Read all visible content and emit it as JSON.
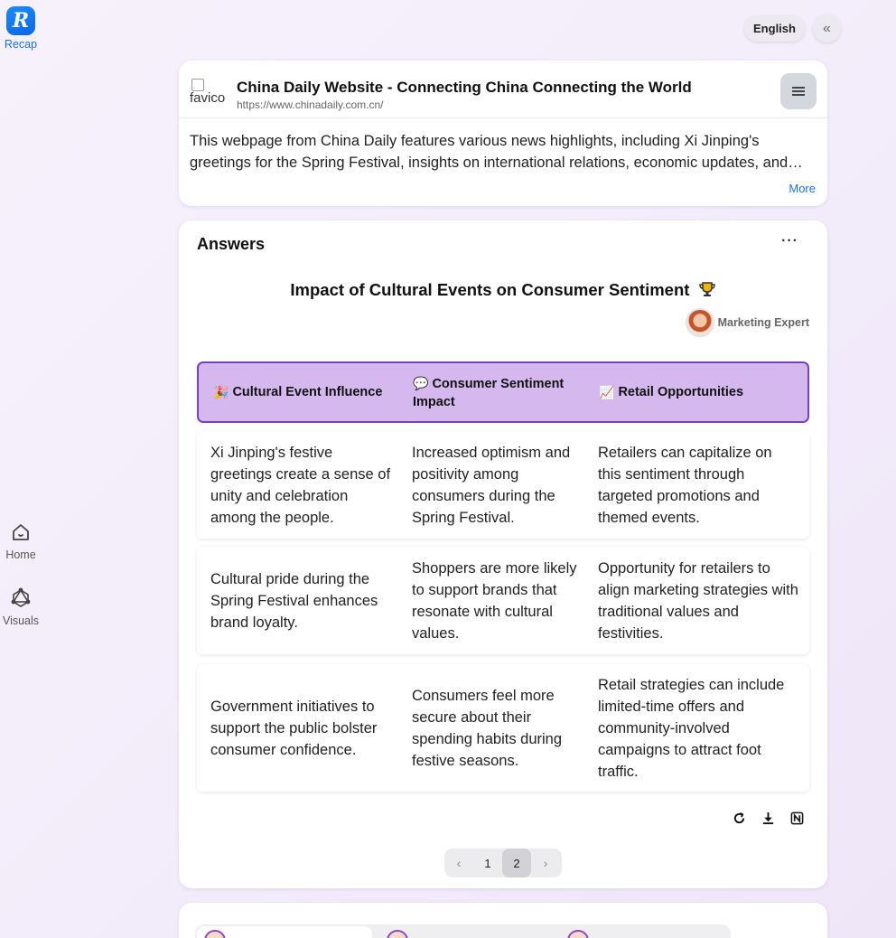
{
  "rail": {
    "logo_label": "Recap",
    "home_label": "Home",
    "visuals_label": "Visuals"
  },
  "topbar": {
    "language": "English",
    "collapse_icon": "double-chevron-left-icon"
  },
  "source": {
    "favicon_alt": "favicon",
    "title": "China Daily Website - Connecting China Connecting the World",
    "url": "https://www.chinadaily.com.cn/",
    "summary": "This webpage from China Daily features various news highlights, including Xi Jinping's greetings for the Spring Festival, insights on international relations, economic updates, and cultural stories.",
    "more_label": "More"
  },
  "answers": {
    "heading": "Answers",
    "menu": "···",
    "table_title": "Impact of Cultural Events on Consumer Sentiment",
    "expert_label": "Marketing Expert",
    "columns": [
      {
        "emoji": "🎉",
        "label": "Cultural Event Influence"
      },
      {
        "emoji": "💬",
        "label": "Consumer Sentiment Impact"
      },
      {
        "emoji": "📈",
        "label": "Retail Opportunities"
      }
    ],
    "rows": [
      [
        "Xi Jinping's festive greetings create a sense of unity and celebration among the people.",
        "Increased optimism and positivity among consumers during the Spring Festival.",
        "Retailers can capitalize on this sentiment through targeted promotions and themed events."
      ],
      [
        "Cultural pride during the Spring Festival enhances brand loyalty.",
        "Shoppers are more likely to support brands that resonate with cultural values.",
        "Opportunity for retailers to align marketing strategies with traditional values and festivities."
      ],
      [
        "Government initiatives to support the public bolster consumer confidence.",
        "Consumers feel more secure about their spending habits during festive seasons.",
        "Retail strategies can include limited-time offers and community-involved campaigns to attract foot traffic."
      ]
    ],
    "pagination": {
      "prev": "‹",
      "pages": [
        "1",
        "2"
      ],
      "current": "2",
      "next": "›"
    }
  },
  "colors": {
    "accent": "#1a73e8",
    "header_fill": "#d5b8ee",
    "header_border": "#7a3fc0"
  }
}
